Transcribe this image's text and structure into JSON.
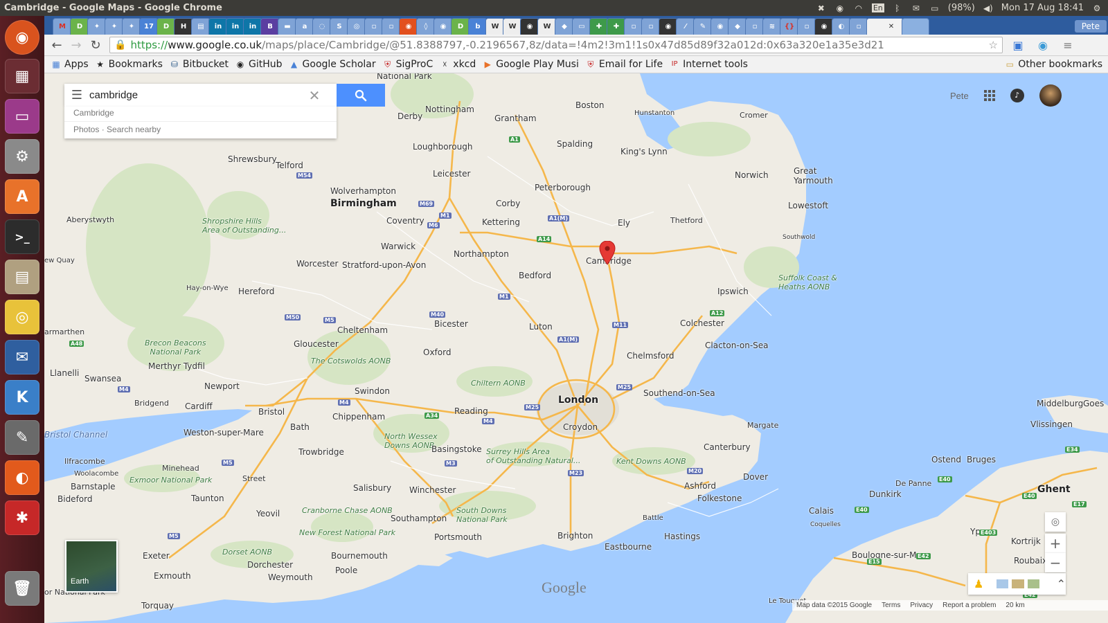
{
  "os": {
    "window_title": "Cambridge - Google Maps - Google Chrome",
    "keyboard": "En",
    "battery": "(98%)",
    "datetime": "Mon 17 Aug 18:41"
  },
  "browser": {
    "profile": "Pete",
    "url": {
      "scheme": "https://",
      "host": "www.google.co.uk",
      "path": "/maps/place/Cambridge/@51.8388797,-0.2196567,8z/data=!4m2!3m1!1s0x47d85d89f32a012d:0x63a320e1a35e3d21"
    },
    "bookmarks": [
      "Apps",
      "Bookmarks",
      "Bitbucket",
      "GitHub",
      "Google Scholar",
      "SigProC",
      "xkcd",
      "Google Play Musi",
      "Email for Life",
      "Internet tools"
    ],
    "other_bookmarks": "Other bookmarks"
  },
  "maps": {
    "search_value": "cambridge",
    "suggestion": "Cambridge",
    "suggestion_actions": "Photos · Search nearby",
    "account_name": "Pete",
    "earth_label": "Earth",
    "logo": "Google",
    "footer": {
      "map_data": "Map data ©2015 Google",
      "terms": "Terms",
      "privacy": "Privacy",
      "report": "Report a problem",
      "scale": "20 km"
    },
    "places": {
      "nottingham": "Nottingham",
      "derby": "Derby",
      "grantham": "Grantham",
      "boston": "Boston",
      "hunstanton": "Hunstanton",
      "cromer": "Cromer",
      "loughborough": "Loughborough",
      "spalding": "Spalding",
      "kings_lynn": "King's Lynn",
      "norwich": "Norwich",
      "great_yarmouth": "Great\nYarmouth",
      "shrewsbury": "Shrewsbury",
      "telford": "Telford",
      "leicester": "Leicester",
      "wolverhampton": "Wolverhampton",
      "birmingham": "Birmingham",
      "peterborough": "Peterborough",
      "lowestoft": "Lowestoft",
      "aberystwyth": "Aberystwyth",
      "corby": "Corby",
      "shropshire": "Shropshire Hills\nArea of Outstanding...",
      "coventry": "Coventry",
      "kettering": "Kettering",
      "ely": "Ely",
      "thetford": "Thetford",
      "southwold": "Southwold",
      "warwick": "Warwick",
      "northampton": "Northampton",
      "cambridge": "Cambridge",
      "new_quay": "ew Quay",
      "worcester": "Worcester",
      "stratford": "Stratford-upon-Avon",
      "suffolk_coast": "Suffolk Coast &\nHeaths AONB",
      "bedford": "Bedford",
      "hay": "Hay-on-Wye",
      "hereford": "Hereford",
      "ipswich": "Ipswich",
      "bicester": "Bicester",
      "luton": "Luton",
      "colchester": "Colchester",
      "cheltenham": "Cheltenham",
      "carmarthen": "armarthen",
      "brecon": "Brecon Beacons\nNational Park",
      "gloucester": "Gloucester",
      "clacton": "Clacton-on-Sea",
      "oxford": "Oxford",
      "chelmsford": "Chelmsford",
      "merthyr": "Merthyr Tydfil",
      "cotswolds": "The Cotswolds AONB",
      "llanelli": "Llanelli",
      "chilterns": "Chiltern AONB",
      "swansea": "Swansea",
      "newport": "Newport",
      "swindon": "Swindon",
      "london": "London",
      "southend": "Southend-on-Sea",
      "bridgend": "Bridgend",
      "cardiff": "Cardiff",
      "bristol": "Bristol",
      "reading": "Reading",
      "chippenham": "Chippenham",
      "croydon": "Croydon",
      "margate": "Margate",
      "middelburg": "Middelburg",
      "goes": "Goes",
      "vlissingen": "Vlissingen",
      "bristol_channel": "Bristol Channel",
      "weston": "Weston-super-Mare",
      "bath": "Bath",
      "north_wessex": "North Wessex\nDowns AONB",
      "canterbury": "Canterbury",
      "trowbridge": "Trowbridge",
      "basingstoke": "Basingstoke",
      "surrey_hills": "Surrey Hills Area\nof Outstanding Natural...",
      "kent_downs": "Kent Downs AONB",
      "ostend": "Ostend",
      "bruges": "Bruges",
      "ilfracombe": "Ilfracombe",
      "minehead": "Minehead",
      "woolacombe": "Woolacombe",
      "exmoor": "Exmoor National Park",
      "street": "Street",
      "dover": "Dover",
      "barnstaple": "Barnstaple",
      "ashford": "Ashford",
      "de_panne": "De Panne",
      "ghent": "Ghent",
      "salisbury": "Salisbury",
      "winchester": "Winchester",
      "dunkirk": "Dunkirk",
      "folkestone": "Folkestone",
      "bideford": "Bideford",
      "taunton": "Taunton",
      "cranborne": "Cranborne Chase AONB",
      "south_downs": "South Downs\nNational Park",
      "calais": "Calais",
      "yeovil": "Yeovil",
      "southampton": "Southampton",
      "battle": "Battle",
      "coquelles": "Coquelles",
      "new_forest": "New Forest National Park",
      "ypres": "Ypres",
      "kortrijk": "Kortrijk",
      "portsmouth": "Portsmouth",
      "brighton": "Brighton",
      "hastings": "Hastings",
      "exeter": "Exeter",
      "dorset": "Dorset AONB",
      "bournemouth": "Bournemouth",
      "eastbourne": "Eastbourne",
      "boulogne": "Boulogne-sur-Mer",
      "roubaix": "Roubaix",
      "dorchester": "Dorchester",
      "exmouth": "Exmouth",
      "weymouth": "Weymouth",
      "poole": "Poole",
      "national_park_top": "National Park",
      "le_touquet": "Le Touquet",
      "torquay": "Torquay",
      "dartmoor": "or National Park"
    },
    "roads": [
      "A1",
      "M54",
      "M69",
      "M1",
      "M6",
      "A1(M)",
      "A14",
      "M1",
      "M50",
      "M5",
      "M40",
      "A12",
      "M11",
      "A1(M)",
      "A48",
      "M4",
      "M25",
      "M25",
      "M4",
      "A34",
      "M4",
      "M3",
      "M23",
      "M20",
      "M5",
      "E34",
      "E40",
      "E40",
      "E40",
      "E17",
      "E403",
      "E42",
      "E15",
      "E42",
      "M5"
    ]
  }
}
